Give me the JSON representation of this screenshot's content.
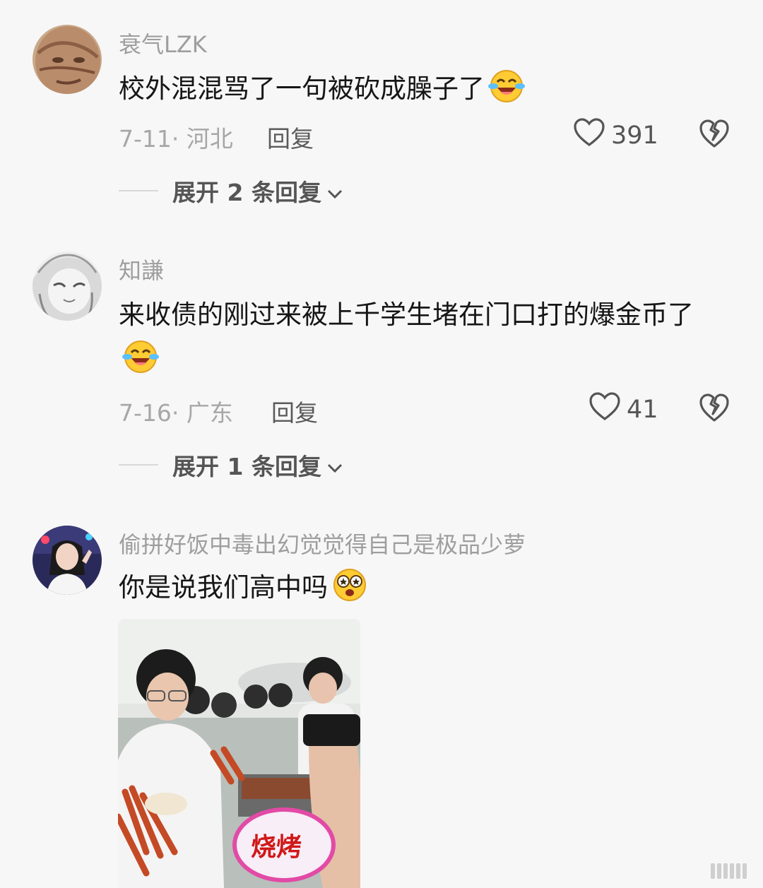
{
  "comments": [
    {
      "username": "衰气LZK",
      "text": "校外混混骂了一句被砍成臊子了",
      "date_location": "7-11· 河北",
      "reply_label": "回复",
      "likes": "391",
      "expand_label": "展开 2 条回复",
      "avatar": "meme-face-avatar",
      "emoji": "laughing-crying-emoji"
    },
    {
      "username": "知謙",
      "text": "来收债的刚过来被上千学生堵在门口打的爆金币了",
      "date_location": "7-16· 广东",
      "reply_label": "回复",
      "likes": "41",
      "expand_label": "展开 1 条回复",
      "avatar": "anime-girl-avatar",
      "emoji": "laughing-crying-emoji"
    },
    {
      "username": "偷拼好饭中毒出幻觉觉得自己是极品少萝",
      "text": "你是说我们高中吗",
      "avatar": "selfie-girl-avatar",
      "emoji": "starry-eyed-emoji",
      "photo_sign_text": "烧烤"
    }
  ],
  "colors": {
    "background": "#f7f7f7",
    "username": "#9e9e9e",
    "text": "#161616",
    "meta": "#a7a7a7"
  }
}
